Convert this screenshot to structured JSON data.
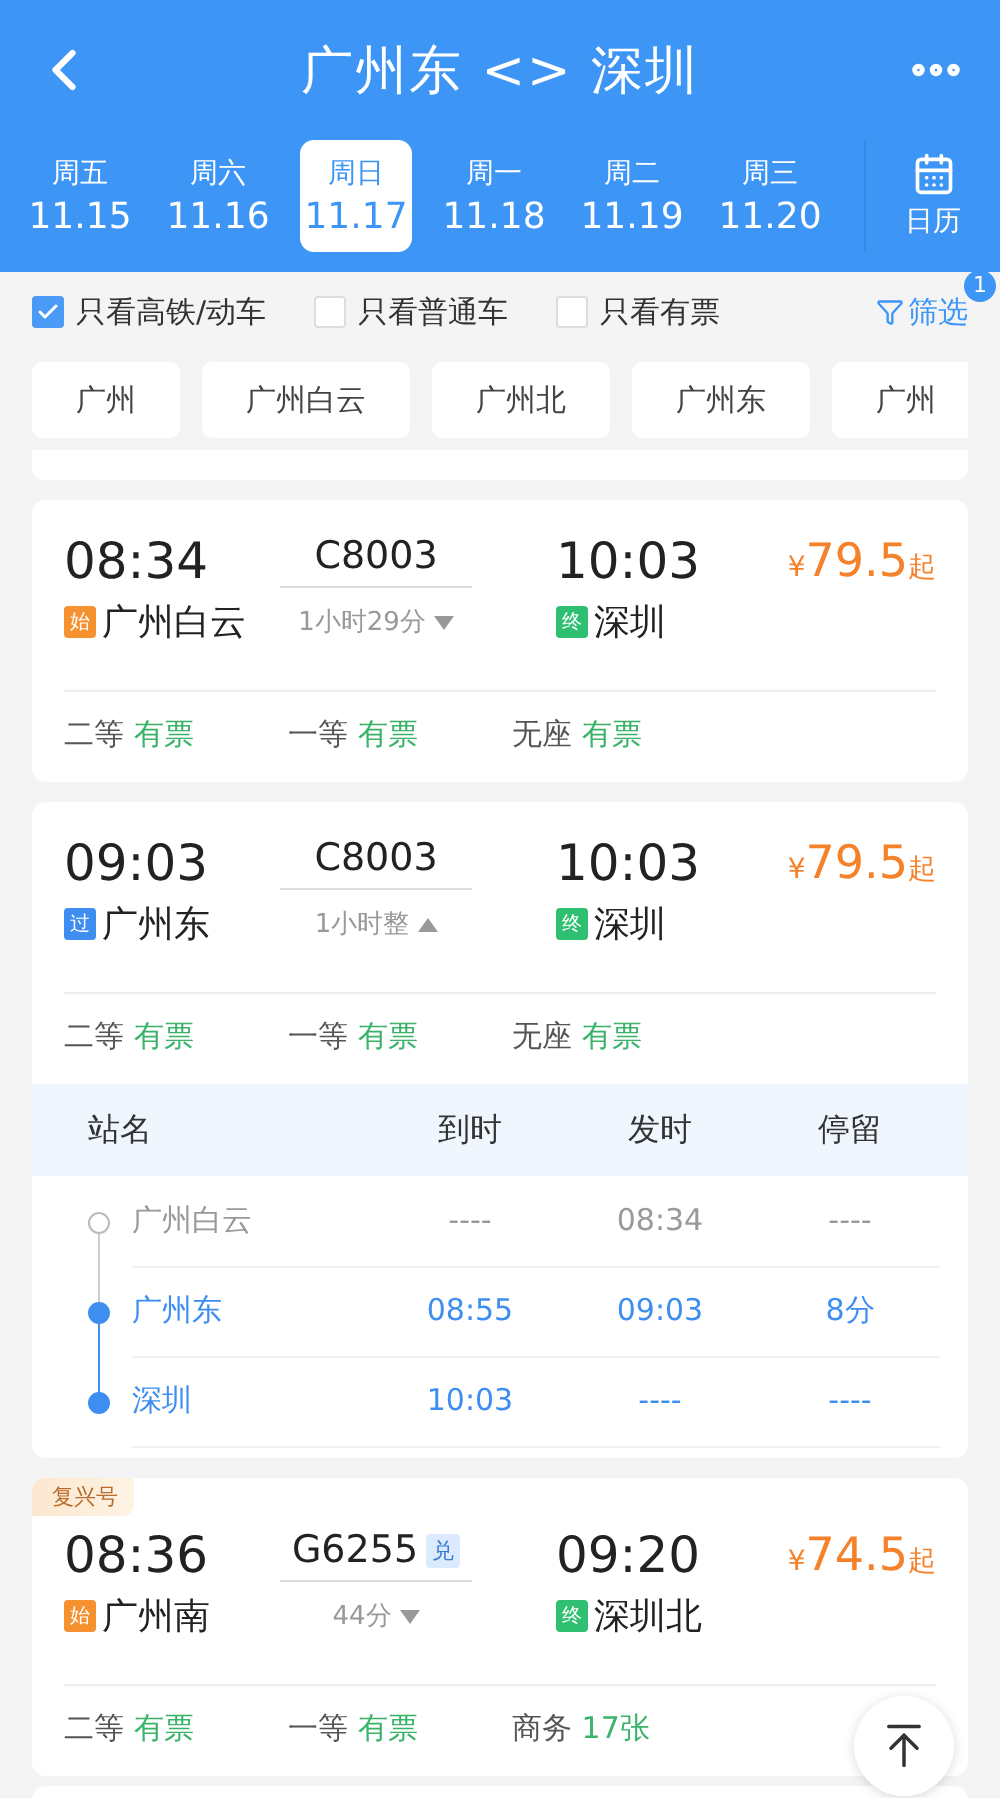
{
  "header": {
    "title": "广州东 <> 深圳"
  },
  "dates": [
    {
      "weekday": "周五",
      "date": "11.15",
      "selected": false
    },
    {
      "weekday": "周六",
      "date": "11.16",
      "selected": false
    },
    {
      "weekday": "周日",
      "date": "11.17",
      "selected": true
    },
    {
      "weekday": "周一",
      "date": "11.18",
      "selected": false
    },
    {
      "weekday": "周二",
      "date": "11.19",
      "selected": false
    },
    {
      "weekday": "周三",
      "date": "11.20",
      "selected": false
    }
  ],
  "calendar": {
    "label": "日历"
  },
  "filters": [
    {
      "label": "只看高铁/动车",
      "checked": true
    },
    {
      "label": "只看普通车",
      "checked": false
    },
    {
      "label": "只看有票",
      "checked": false
    }
  ],
  "filter_button": {
    "label": "筛选",
    "badge": "1"
  },
  "stations": [
    "广州",
    "广州白云",
    "广州北",
    "广州东",
    "广州"
  ],
  "trains": [
    {
      "depart": "08:34",
      "train_no": "C8003",
      "arrive": "10:03",
      "currency": "¥",
      "price": "79.5",
      "price_suffix": "起",
      "from_mark": {
        "kind": "start",
        "text": "始"
      },
      "from": "广州白云",
      "to_mark": {
        "kind": "end",
        "text": "终"
      },
      "to": "深圳",
      "duration": "1小时29分",
      "expanded": false,
      "seats": [
        {
          "class": "二等",
          "status": "有票"
        },
        {
          "class": "一等",
          "status": "有票"
        },
        {
          "class": "无座",
          "status": "有票"
        }
      ]
    },
    {
      "depart": "09:03",
      "train_no": "C8003",
      "arrive": "10:03",
      "currency": "¥",
      "price": "79.5",
      "price_suffix": "起",
      "from_mark": {
        "kind": "pass",
        "text": "过"
      },
      "from": "广州东",
      "to_mark": {
        "kind": "end",
        "text": "终"
      },
      "to": "深圳",
      "duration": "1小时整",
      "expanded": true,
      "seats": [
        {
          "class": "二等",
          "status": "有票"
        },
        {
          "class": "一等",
          "status": "有票"
        },
        {
          "class": "无座",
          "status": "有票"
        }
      ],
      "stops": {
        "columns": [
          "站名",
          "到时",
          "发时",
          "停留"
        ],
        "rows": [
          {
            "name": "广州白云",
            "arrive": "----",
            "depart": "08:34",
            "stay": "----",
            "on_route": false
          },
          {
            "name": "广州东",
            "arrive": "08:55",
            "depart": "09:03",
            "stay": "8分",
            "on_route": true
          },
          {
            "name": "深圳",
            "arrive": "10:03",
            "depart": "----",
            "stay": "----",
            "on_route": true
          }
        ]
      }
    },
    {
      "tag": "复兴号",
      "depart": "08:36",
      "train_no": "G6255",
      "exchange": "兑",
      "arrive": "09:20",
      "currency": "¥",
      "price": "74.5",
      "price_suffix": "起",
      "from_mark": {
        "kind": "start",
        "text": "始"
      },
      "from": "广州南",
      "to_mark": {
        "kind": "end",
        "text": "终"
      },
      "to": "深圳北",
      "duration": "44分",
      "expanded": false,
      "seats": [
        {
          "class": "二等",
          "status": "有票"
        },
        {
          "class": "一等",
          "status": "有票"
        },
        {
          "class": "商务",
          "status": "17张"
        }
      ]
    }
  ]
}
